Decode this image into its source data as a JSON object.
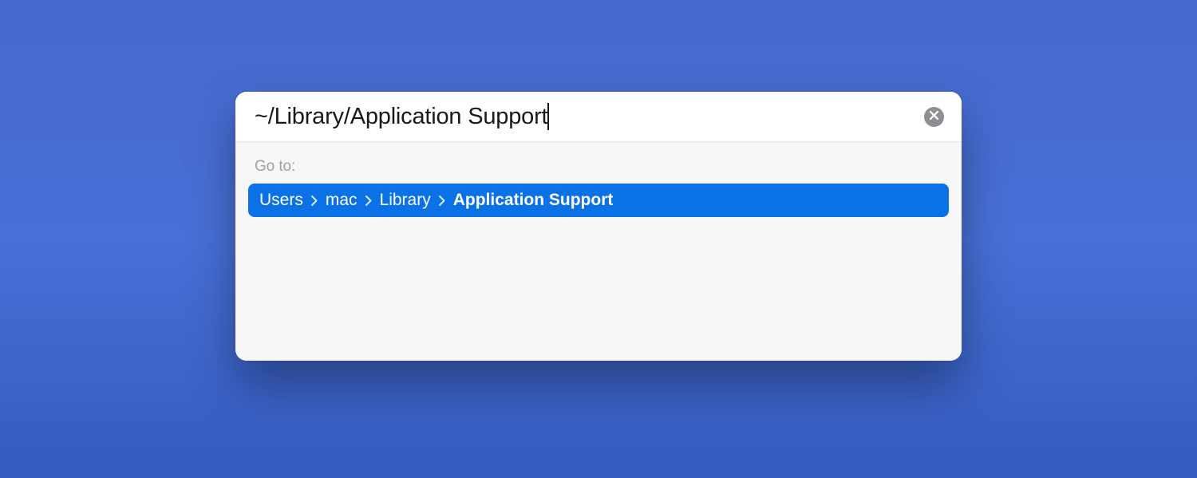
{
  "input": {
    "value": "~/Library/Application Support"
  },
  "results": {
    "label": "Go to:",
    "breadcrumb": {
      "segments": [
        "Users",
        "mac",
        "Library",
        "Application Support"
      ],
      "bold_index": 3
    }
  },
  "colors": {
    "accent": "#0a72e6",
    "background": "#4770d8",
    "dialog_bg": "#fdfdfd",
    "results_bg": "#f7f7f9",
    "label_muted": "#a0a0a5"
  }
}
